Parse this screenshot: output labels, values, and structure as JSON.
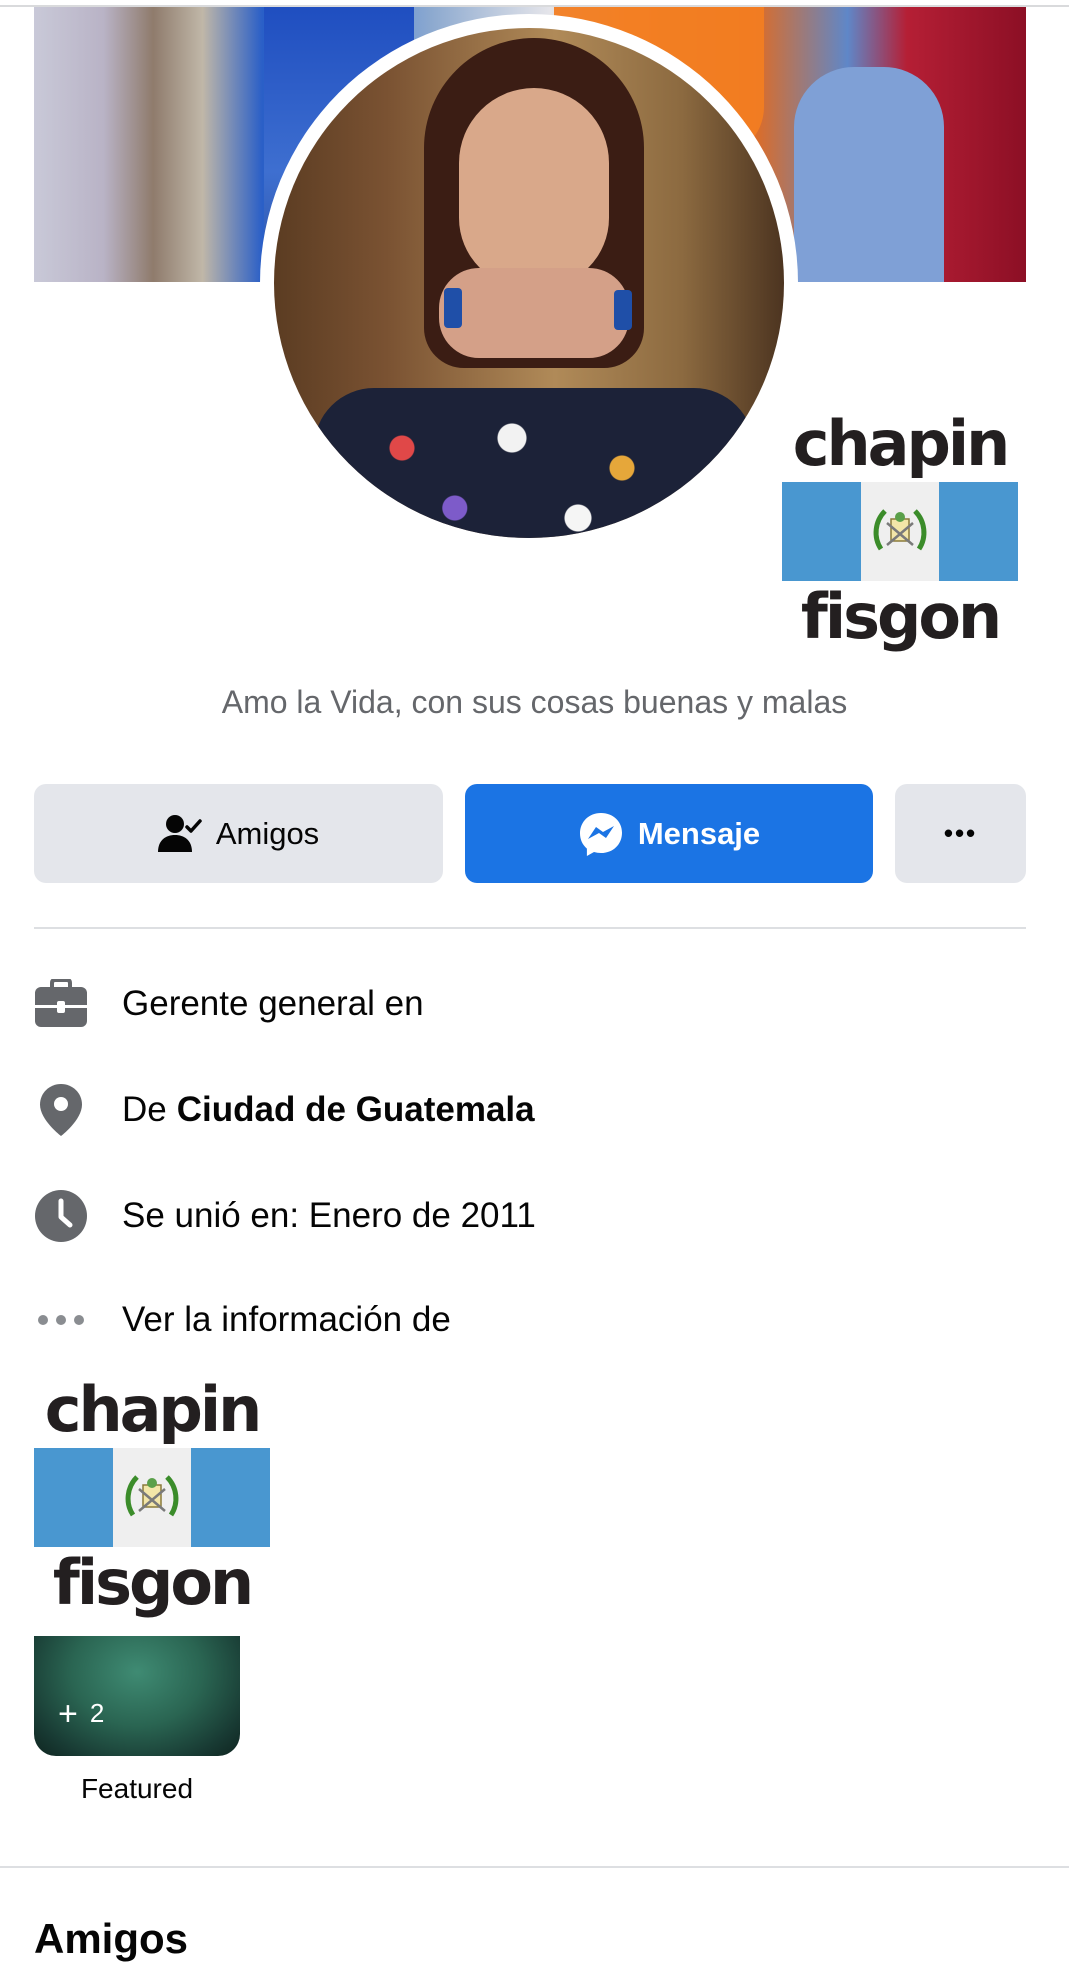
{
  "profile": {
    "bio": "Amo la Vida, con sus cosas buenas y malas",
    "logo": {
      "word_top": "chapin",
      "word_bottom": "fisgon"
    }
  },
  "actions": {
    "friends_label": "Amigos",
    "message_label": "Mensaje",
    "more_label": "•••"
  },
  "info": {
    "work": "Gerente general en",
    "place_prefix": "De",
    "place_name": "Ciudad de Guatemala",
    "joined": "Se unió en: Enero de 2011",
    "more_info": "Ver la información de"
  },
  "featured": {
    "count": "2",
    "plus": "+",
    "label": "Featured"
  },
  "friends_section": {
    "title": "Amigos"
  },
  "colors": {
    "primary": "#1b74e4",
    "secondary_button": "#e4e6eb",
    "muted_text": "#65676b",
    "icon_gray": "#65676b",
    "flag_blue": "#4997d0"
  },
  "icons": {
    "friends": "person-check-icon",
    "message": "messenger-icon",
    "more": "more-dots-icon",
    "work": "briefcase-icon",
    "place": "location-pin-icon",
    "joined": "clock-icon",
    "more_info": "ellipsis-icon"
  }
}
